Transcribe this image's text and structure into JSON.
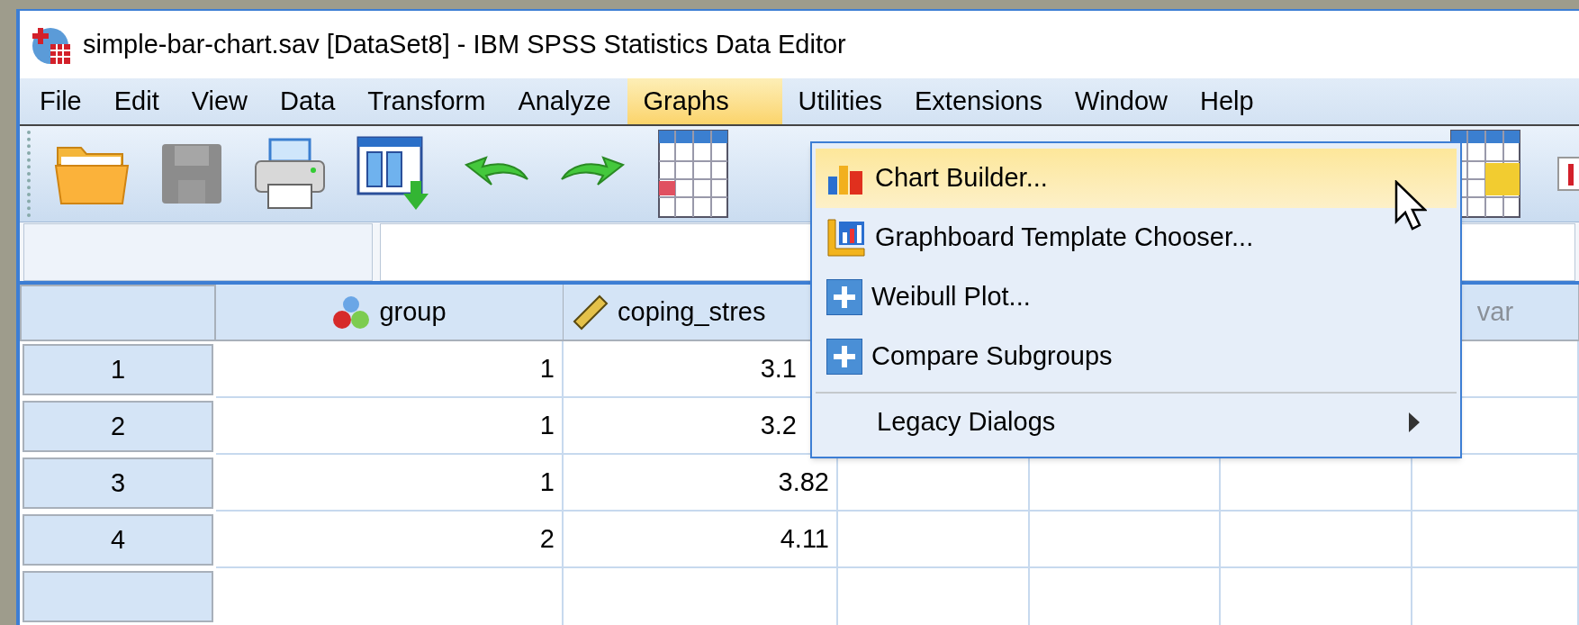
{
  "window": {
    "title": "simple-bar-chart.sav [DataSet8] - IBM SPSS Statistics Data Editor"
  },
  "menu_bar": [
    {
      "label": "File",
      "selected": false
    },
    {
      "label": "Edit",
      "selected": false
    },
    {
      "label": "View",
      "selected": false
    },
    {
      "label": "Data",
      "selected": false
    },
    {
      "label": "Transform",
      "selected": false
    },
    {
      "label": "Analyze",
      "selected": false
    },
    {
      "label": "Graphs",
      "selected": true
    },
    {
      "label": "Utilities",
      "selected": false
    },
    {
      "label": "Extensions",
      "selected": false
    },
    {
      "label": "Window",
      "selected": false
    },
    {
      "label": "Help",
      "selected": false
    }
  ],
  "toolbar": {
    "save": {
      "disabled": true
    }
  },
  "graphs_menu": {
    "items": [
      {
        "label": "Chart Builder...",
        "kind": "chart",
        "selected": true,
        "separator_before": false
      },
      {
        "label": "Graphboard Template Chooser...",
        "kind": "graphboard",
        "selected": false,
        "separator_before": false
      },
      {
        "label": "Weibull Plot...",
        "kind": "plus",
        "selected": false,
        "separator_before": false
      },
      {
        "label": "Compare Subgroups",
        "kind": "plus",
        "selected": false,
        "separator_before": false
      },
      {
        "label": "Legacy Dialogs",
        "kind": "submenu",
        "selected": false,
        "separator_before": true
      }
    ]
  },
  "grid": {
    "columns": [
      {
        "name": "group",
        "kind": "nominal"
      },
      {
        "name": "coping_stres",
        "kind": "scale"
      },
      {
        "kind": "blank"
      },
      {
        "kind": "blank"
      },
      {
        "kind": "blank"
      },
      {
        "name": "var",
        "kind": "empty"
      }
    ],
    "rows": [
      {
        "number": "1",
        "cells": [
          "1",
          "3.1"
        ],
        "covered": true
      },
      {
        "number": "2",
        "cells": [
          "1",
          "3.2"
        ],
        "covered": true
      },
      {
        "number": "3",
        "cells": [
          "1",
          "3.82"
        ],
        "covered": false
      },
      {
        "number": "4",
        "cells": [
          "2",
          "4.11"
        ],
        "covered": false
      }
    ]
  }
}
